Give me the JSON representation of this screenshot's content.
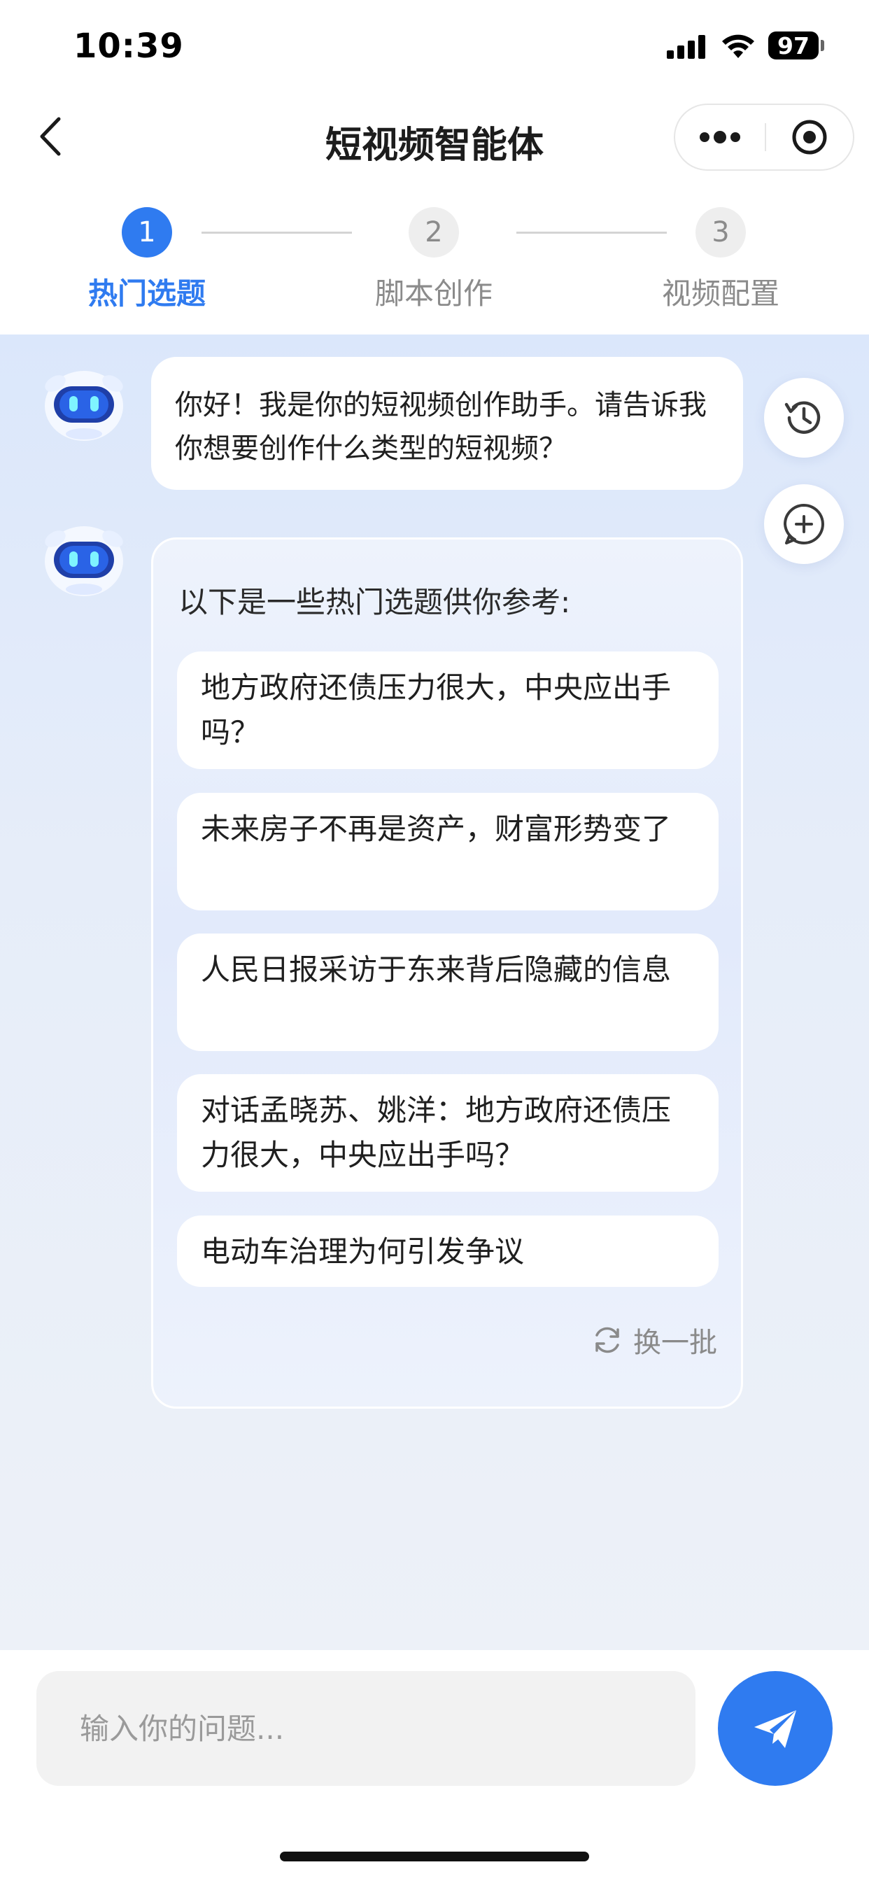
{
  "status_bar": {
    "time": "10:39",
    "battery": "97"
  },
  "header": {
    "title": "短视频智能体",
    "icons": [
      "back-icon",
      "more-icon",
      "close-target-icon"
    ]
  },
  "steps": [
    {
      "number": "1",
      "label": "热门选题",
      "state": "active"
    },
    {
      "number": "2",
      "label": "脚本创作",
      "state": "inactive"
    },
    {
      "number": "3",
      "label": "视频配置",
      "state": "inactive"
    }
  ],
  "chat": {
    "greeting": "你好！我是你的短视频创作助手。请告诉我你想要创作什么类型的短视频？",
    "topics_intro": "以下是一些热门选题供你参考:",
    "topics": [
      "地方政府还债压力很大，中央应出手吗？",
      "未来房子不再是资产，财富形势变了",
      "人民日报采访于东来背后隐藏的信息",
      "对话孟晓苏、姚洋：地方政府还债压力很大，中央应出手吗？",
      "电动车治理为何引发争议"
    ],
    "refresh_label": "换一批"
  },
  "side_buttons": [
    "history-icon",
    "new-chat-icon"
  ],
  "input": {
    "placeholder": "输入你的问题...",
    "value": ""
  },
  "colors": {
    "accent": "#2f7bf0",
    "inactive": "#8b8b8b",
    "chat_bg": "#e3ebfa"
  }
}
